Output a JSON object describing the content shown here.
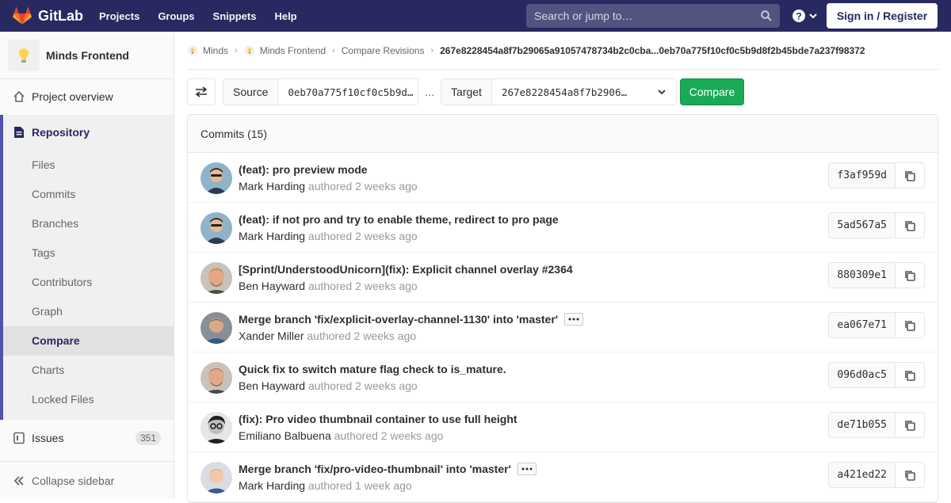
{
  "topnav": {
    "brand": "GitLab",
    "links": [
      "Projects",
      "Groups",
      "Snippets",
      "Help"
    ],
    "search_placeholder": "Search or jump to…",
    "signin_label": "Sign in / Register",
    "bg_color": "#292961"
  },
  "sidebar": {
    "project_name": "Minds Frontend",
    "project_overview": "Project overview",
    "repository": "Repository",
    "repo_items": [
      "Files",
      "Commits",
      "Branches",
      "Tags",
      "Contributors",
      "Graph",
      "Compare",
      "Charts",
      "Locked Files"
    ],
    "active_item": "Compare",
    "issues_label": "Issues",
    "issues_count": "351",
    "collapse_label": "Collapse sidebar"
  },
  "breadcrumb": {
    "items": [
      "Minds",
      "Minds Frontend",
      "Compare Revisions"
    ],
    "current": "267e8228454a8f7b29065a91057478734b2c0cba...0eb70a775f10cf0c5b9d8f2b45bde7a237f98372"
  },
  "compare": {
    "source_label": "Source",
    "source_value": "0eb70a775f10cf0c5b9d…",
    "separator": "...",
    "target_label": "Target",
    "target_value": "267e8228454a8f7b2906…",
    "button_label": "Compare"
  },
  "commits": {
    "header": "Commits (15)",
    "list": [
      {
        "title": "(feat): pro preview mode",
        "author": "Mark Harding",
        "time": "authored 2 weeks ago",
        "sha": "f3af959d",
        "merge": false
      },
      {
        "title": "(feat): if not pro and try to enable theme, redirect to pro page",
        "author": "Mark Harding",
        "time": "authored 2 weeks ago",
        "sha": "5ad567a5",
        "merge": false
      },
      {
        "title": "[Sprint/UnderstoodUnicorn](fix): Explicit channel overlay #2364",
        "author": "Ben Hayward",
        "time": "authored 2 weeks ago",
        "sha": "880309e1",
        "merge": false
      },
      {
        "title": "Merge branch 'fix/explicit-overlay-channel-1130' into 'master'",
        "author": "Xander Miller",
        "time": "authored 2 weeks ago",
        "sha": "ea067e71",
        "merge": true
      },
      {
        "title": "Quick fix to switch mature flag check to is_mature.",
        "author": "Ben Hayward",
        "time": "authored 2 weeks ago",
        "sha": "096d0ac5",
        "merge": false
      },
      {
        "title": "(fix): Pro video thumbnail container to use full height",
        "author": "Emiliano Balbuena",
        "time": "authored 2 weeks ago",
        "sha": "de71b055",
        "merge": false
      },
      {
        "title": "Merge branch 'fix/pro-video-thumbnail' into 'master'",
        "author": "Mark Harding",
        "time": "authored 1 week ago",
        "sha": "a421ed22",
        "merge": true
      }
    ]
  }
}
